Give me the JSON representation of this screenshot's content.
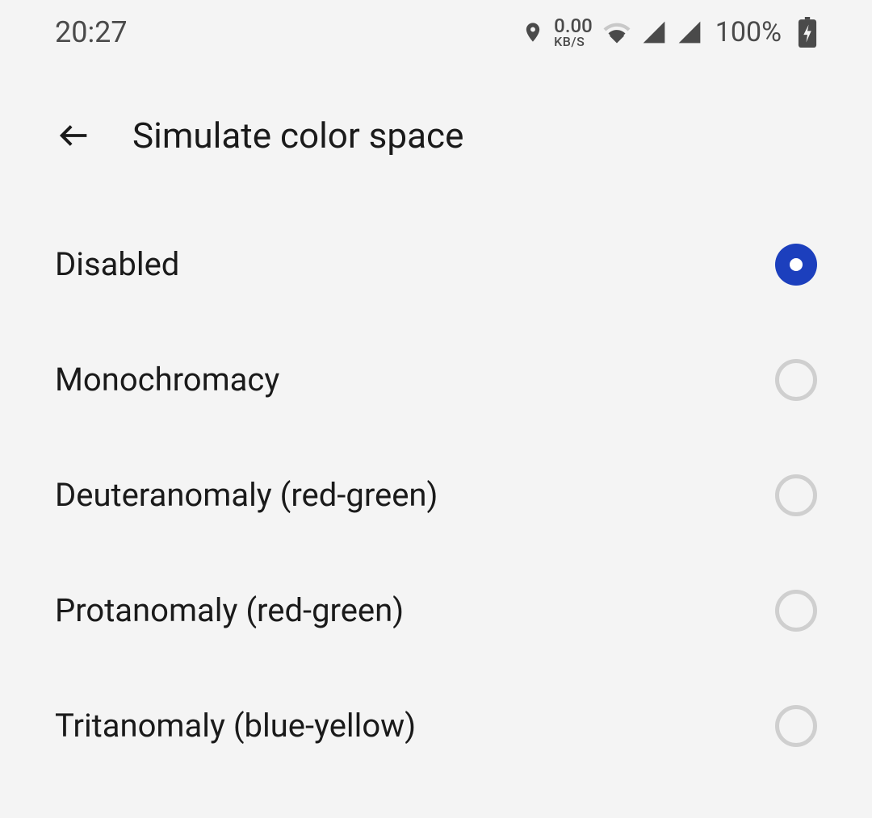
{
  "statusBar": {
    "time": "20:27",
    "networkSpeedValue": "0.00",
    "networkSpeedUnit": "KB/S",
    "batteryPercent": "100%"
  },
  "header": {
    "title": "Simulate color space"
  },
  "options": [
    {
      "label": "Disabled",
      "selected": true
    },
    {
      "label": "Monochromacy",
      "selected": false
    },
    {
      "label": "Deuteranomaly (red-green)",
      "selected": false
    },
    {
      "label": "Protanomaly (red-green)",
      "selected": false
    },
    {
      "label": "Tritanomaly (blue-yellow)",
      "selected": false
    }
  ]
}
